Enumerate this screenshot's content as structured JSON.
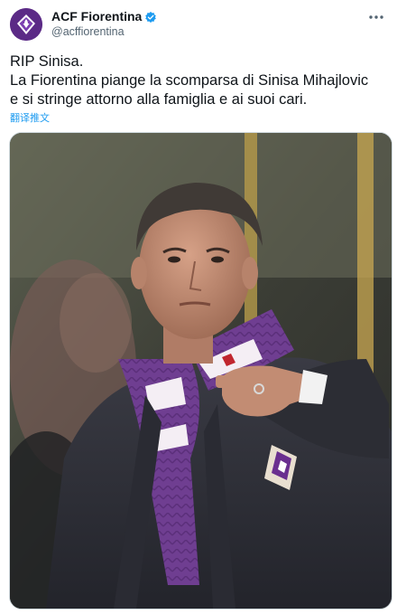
{
  "tweet": {
    "display_name": "ACF Fiorentina",
    "handle": "@acffiorentina",
    "verified": true,
    "text_lines": [
      "RIP Sinisa.",
      "La Fiorentina piange la scomparsa di Sinisa Mihajlovic",
      "e si stringe attorno alla famiglia e ai suoi cari."
    ],
    "translate_label": "翻译推文",
    "more_icon": "more-horizontal-icon",
    "avatar_icon": "fiorentina-crest-icon",
    "verified_icon": "verified-badge-icon"
  },
  "colors": {
    "accent": "#1d9bf0",
    "brand_purple": "#5b2a86",
    "text_primary": "#0f1419",
    "text_secondary": "#536471"
  }
}
